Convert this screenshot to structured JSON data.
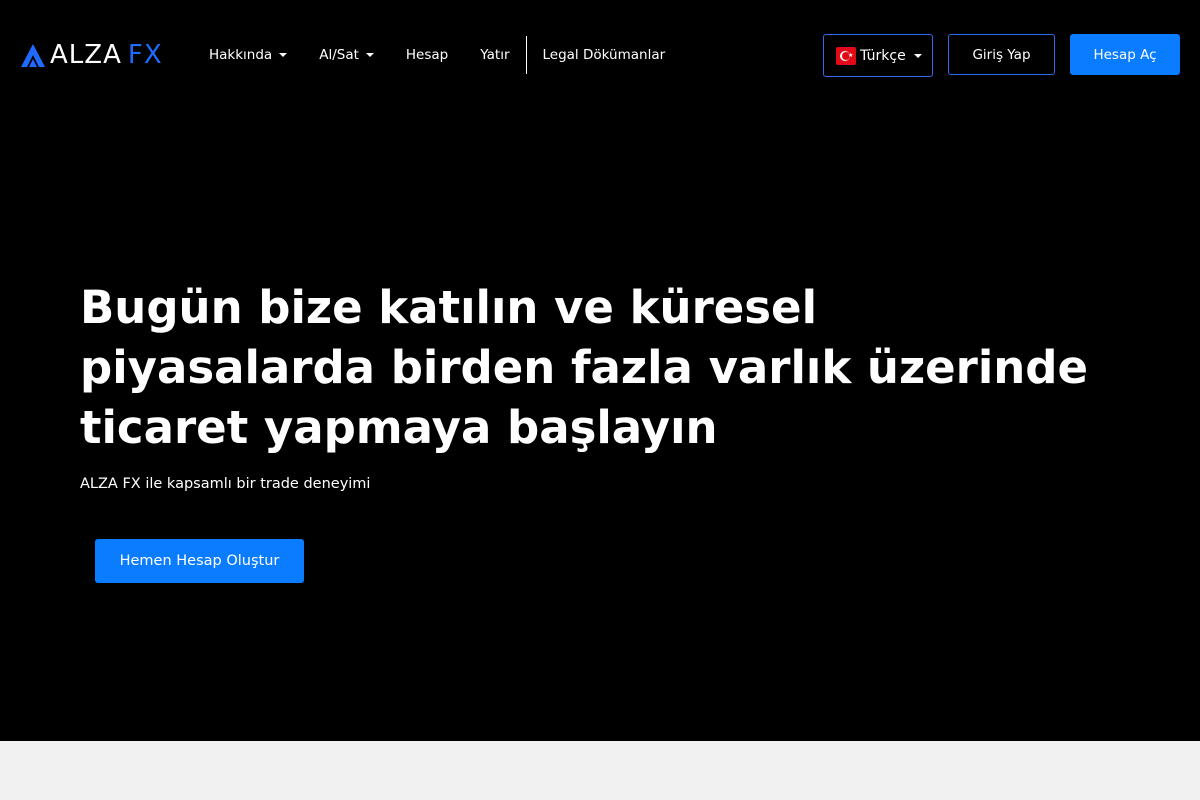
{
  "brand": {
    "name_main": "ALZA",
    "name_accent": "FX",
    "accent_color": "#1f6bff"
  },
  "nav": {
    "items": [
      {
        "label": "Hakkında",
        "has_dropdown": true
      },
      {
        "label": "Al/Sat",
        "has_dropdown": true
      },
      {
        "label": "Hesap",
        "has_dropdown": false
      },
      {
        "label": "Yatır",
        "has_dropdown": false
      },
      {
        "label": "Legal Dökümanlar",
        "has_dropdown": false
      }
    ]
  },
  "language": {
    "selected": "Türkçe",
    "flag_icon": "turkey-flag-icon"
  },
  "auth": {
    "login_label": "Giriş Yap",
    "signup_label": "Hesap Aç"
  },
  "hero": {
    "headline_lines": [
      "Bugün bize katılın ve küresel",
      "piyasalarda birden fazla varlık üzerinde",
      "ticaret yapmaya başlayın"
    ],
    "subline": "ALZA FX ile kapsamlı bir trade deneyimi",
    "cta_label": "Hemen Hesap Oluştur"
  },
  "colors": {
    "hero_background": "#000000",
    "primary_button": "#0a7cff",
    "outline_border": "#2f6cf0",
    "lower_background": "#f1f1f1"
  }
}
